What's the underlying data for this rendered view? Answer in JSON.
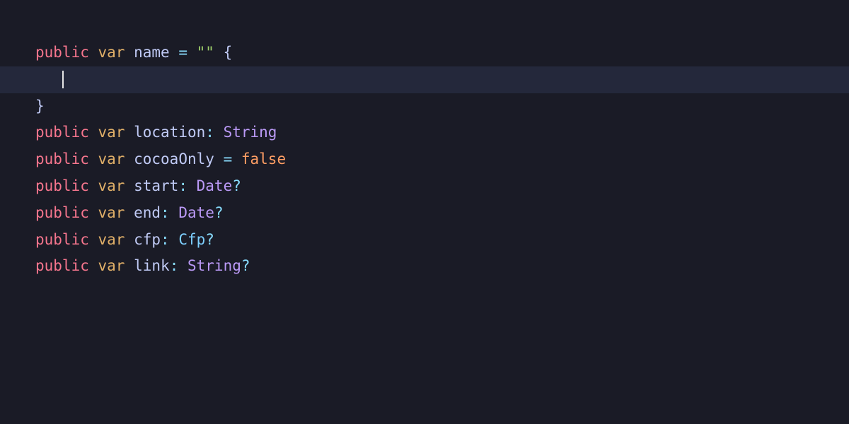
{
  "editor": {
    "language": "swift",
    "cursor_line_index": 1,
    "keywords": {
      "public": "public",
      "var": "var"
    },
    "tokens": {
      "eq": "=",
      "colon": ":",
      "qmark": "?",
      "lbrace": "{",
      "rbrace": "}",
      "empty_string": "\"\"",
      "false": "false"
    },
    "lines": [
      {
        "var": "name",
        "rhs_kind": "string_literal",
        "rhs": "\"\"",
        "trailing_brace": true
      },
      {
        "cursor": true
      },
      {
        "closing_brace": true
      },
      {
        "var": "location",
        "type": "String",
        "optional": false
      },
      {
        "var": "cocoaOnly",
        "rhs_kind": "bool",
        "rhs": "false"
      },
      {
        "var": "start",
        "type": "Date",
        "optional": true
      },
      {
        "var": "end",
        "type": "Date",
        "optional": true
      },
      {
        "var": "cfp",
        "type": "Cfp",
        "type_style": "alt",
        "optional": true
      },
      {
        "var": "link",
        "type": "String",
        "optional": true
      }
    ]
  }
}
